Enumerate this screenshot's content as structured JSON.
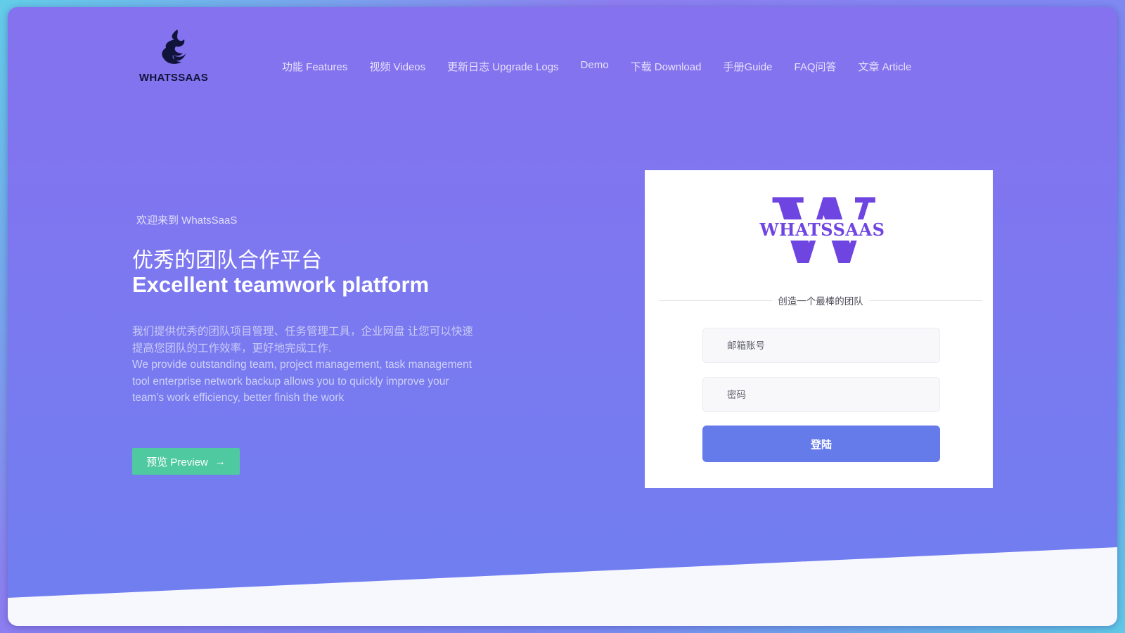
{
  "brand": {
    "logo_text": "WHATSSAAS"
  },
  "nav": {
    "items": [
      {
        "label": "功能 Features"
      },
      {
        "label": "视频 Videos"
      },
      {
        "label": "更新日志 Upgrade Logs"
      },
      {
        "label": "Demo"
      },
      {
        "label": "下载 Download"
      },
      {
        "label": "手册Guide"
      },
      {
        "label": "FAQ问答"
      },
      {
        "label": "文章 Article"
      }
    ]
  },
  "hero": {
    "kicker": "欢迎来到 WhatsSaaS",
    "title_cn": "优秀的团队合作平台",
    "title_en": "Excellent teamwork platform",
    "desc_cn": "我们提供优秀的团队项目管理、任务管理工具，企业网盘 让您可以快速提高您团队的工作效率，更好地完成工作.",
    "desc_en": "We provide outstanding team, project management, task management tool enterprise network backup allows you to quickly improve your team's work efficiency, better finish the work",
    "preview_label": "预览 Preview",
    "preview_icon": "arrow-right-icon"
  },
  "login": {
    "logo_letter": "W",
    "logo_text": "WHATSSAAS",
    "tagline": "创造一个最棒的团队",
    "email_placeholder": "邮箱账号",
    "password_placeholder": "密码",
    "submit_label": "登陆"
  },
  "colors": {
    "accent": "#6f45e2",
    "preview_button": "#4fc9a0",
    "login_button": "#657bea"
  }
}
